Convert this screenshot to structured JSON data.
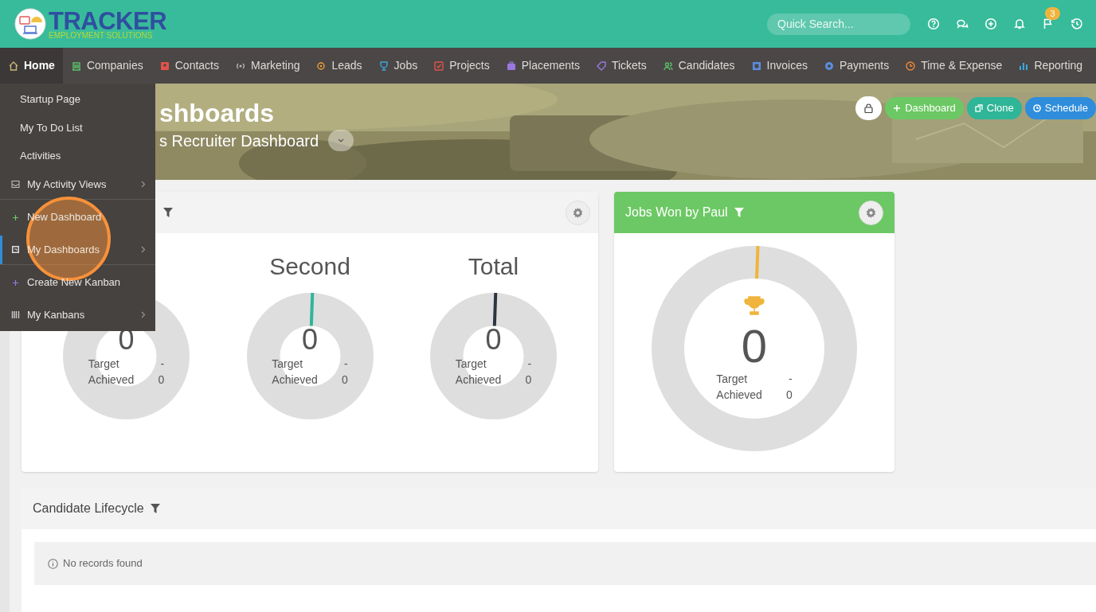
{
  "logo": {
    "title": "TRACKER",
    "subtitle": "EMPLOYMENT SOLUTIONS"
  },
  "search": {
    "placeholder": "Quick Search..."
  },
  "notifications_badge": "3",
  "nav": [
    {
      "label": "Home",
      "selected": true
    },
    {
      "label": "Companies",
      "selected": false
    },
    {
      "label": "Contacts",
      "selected": false
    },
    {
      "label": "Marketing",
      "selected": false
    },
    {
      "label": "Leads",
      "selected": false
    },
    {
      "label": "Jobs",
      "selected": false
    },
    {
      "label": "Projects",
      "selected": false
    },
    {
      "label": "Placements",
      "selected": false
    },
    {
      "label": "Tickets",
      "selected": false
    },
    {
      "label": "Candidates",
      "selected": false
    },
    {
      "label": "Invoices",
      "selected": false
    },
    {
      "label": "Payments",
      "selected": false
    },
    {
      "label": "Time & Expense",
      "selected": false
    },
    {
      "label": "Reporting",
      "selected": false
    }
  ],
  "menu": [
    {
      "label": "Startup Page",
      "kind": "link",
      "selected": false
    },
    {
      "label": "My To Do List",
      "kind": "link",
      "selected": false
    },
    {
      "label": "Activities",
      "kind": "link",
      "selected": false
    },
    {
      "label": "My Activity Views",
      "kind": "submenu",
      "selected": false
    },
    {
      "label": "New Dashboard",
      "kind": "action",
      "selected": false
    },
    {
      "label": "My Dashboards",
      "kind": "submenu",
      "selected": true
    },
    {
      "label": "Create New Kanban",
      "kind": "action",
      "selected": false
    },
    {
      "label": "My Kanbans",
      "kind": "submenu",
      "selected": false
    }
  ],
  "hero": {
    "title": "shboards",
    "subtitle": "s Recruiter Dashboard",
    "buttons": [
      {
        "label": "Dashboard",
        "kind": "add"
      },
      {
        "label": "Clone",
        "kind": "clone"
      },
      {
        "label": "Schedule",
        "kind": "schedule"
      }
    ]
  },
  "target_card": {
    "gauges": [
      {
        "value": "0",
        "target_label": "Target",
        "target": "-",
        "achieved_label": "Achieved",
        "achieved": "0"
      },
      {
        "title": "Second",
        "value": "0",
        "target_label": "Target",
        "target": "-",
        "achieved_label": "Achieved",
        "achieved": "0",
        "color": "#2fb597"
      },
      {
        "title": "Total",
        "value": "0",
        "target_label": "Target",
        "target": "-",
        "achieved_label": "Achieved",
        "achieved": "0",
        "color": "#2c3440"
      }
    ]
  },
  "jobs_card": {
    "title": "Jobs Won by Paul",
    "gauge": {
      "value": "0",
      "target_label": "Target",
      "target": "-",
      "achieved_label": "Achieved",
      "achieved": "0",
      "color": "#f0b43c"
    }
  },
  "lifecycle": {
    "title": "Candidate Lifecycle",
    "message": "No records found"
  }
}
